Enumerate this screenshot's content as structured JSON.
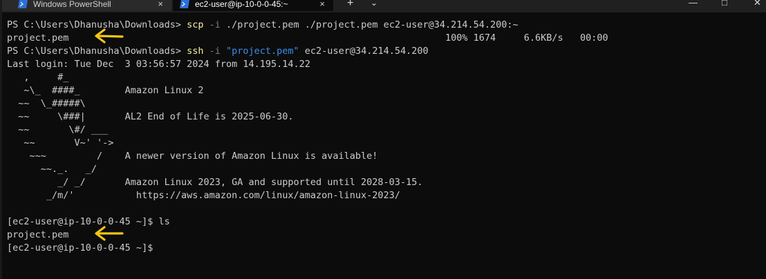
{
  "tabs": [
    {
      "title": "Windows PowerShell",
      "close_glyph": "×"
    },
    {
      "title": "ec2-user@ip-10-0-0-45:~",
      "close_glyph": "×"
    }
  ],
  "tab_controls": {
    "new_tab": "+",
    "dropdown": "⌄"
  },
  "window_controls": {
    "minimize": "—",
    "maximize": "□",
    "close": "✕"
  },
  "terminal": {
    "line1": {
      "prompt": "PS C:\\Users\\Dhanusha\\Downloads> ",
      "cmd": "scp",
      "flag": " -i",
      "args": " ./project.pem ./project.pem ec2-user@34.214.54.200:~"
    },
    "line2": {
      "text": "project.pem                                                                   100% 1674     6.6KB/s   00:00"
    },
    "line3": {
      "prompt": "PS C:\\Users\\Dhanusha\\Downloads> ",
      "cmd": "ssh",
      "flag": " -i",
      "str": " \"project.pem\"",
      "args": " ec2-user@34.214.54.200"
    },
    "line4": {
      "text": "Last login: Tue Dec  3 03:56:57 2024 from 14.195.14.22"
    },
    "banner": [
      "   ,     #_",
      "   ~\\_  ####_        Amazon Linux 2",
      "  ~~  \\_#####\\",
      "  ~~     \\###|       AL2 End of Life is 2025-06-30.",
      "  ~~       \\#/ ___",
      "   ~~       V~' '->",
      "    ~~~         /    A newer version of Amazon Linux is available!",
      "      ~~._.   _/",
      "         _/ _/       Amazon Linux 2023, GA and supported until 2028-03-15.",
      "       _/m/'           https://aws.amazon.com/linux/amazon-linux-2023/",
      ""
    ],
    "line_ls": {
      "text": "[ec2-user@ip-10-0-0-45 ~]$ ls"
    },
    "line_ls_out": {
      "text": "project.pem"
    },
    "line_prompt": {
      "text": "[ec2-user@ip-10-0-0-45 ~]$"
    }
  },
  "colors": {
    "background": "#0c0c0c",
    "text": "#cccccc",
    "command": "#f9f1a5",
    "string": "#3b8eea",
    "annotation_arrow": "#f5c518"
  },
  "icons": {
    "tab_icon": "powershell-icon",
    "annotation": "arrow-left-icon"
  }
}
